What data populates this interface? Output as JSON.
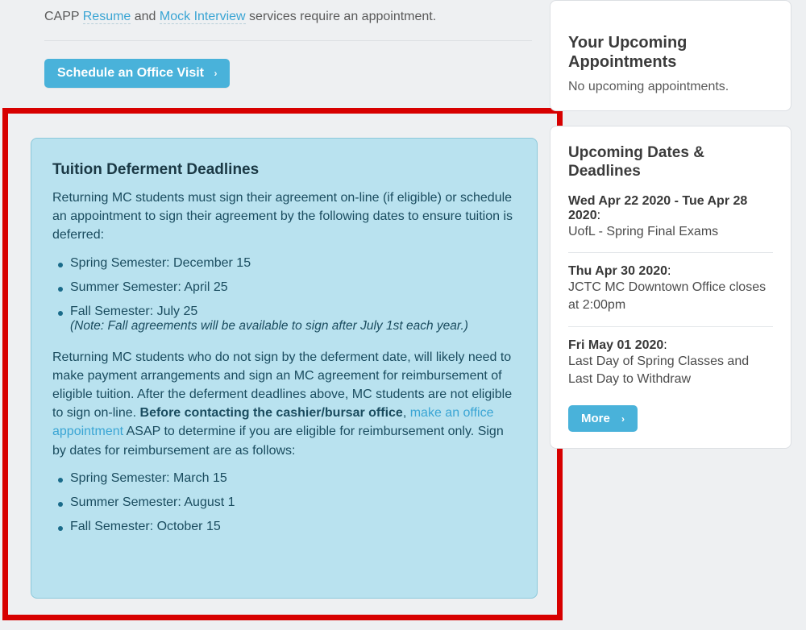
{
  "intro": {
    "prefix": "CAPP ",
    "link1": "Resume",
    "middle": " and ",
    "link2": "Mock Interview",
    "suffix": " services require an appointment."
  },
  "schedule_btn": "Schedule an Office Visit",
  "panel": {
    "heading": "Tuition Deferment Deadlines",
    "para1": "Returning MC students must sign their agreement on-line (if eligible) or schedule an appointment to sign their agreement by the following dates to ensure tuition is deferred:",
    "list1": {
      "li1": "Spring Semester: December 15",
      "li2": "Summer Semester: April 25",
      "li3": "Fall Semester: July 25",
      "li3_note": "(Note: Fall agreements will be available to sign after July 1st each year.)"
    },
    "para2_a": "Returning MC students who do not sign by the deferment date, will likely need to make payment arrangements and sign an MC agreement for reimbursement of eligible tuition. After the deferment deadlines above, MC students are not eligible to sign on-line. ",
    "para2_bold": "Before contacting the cashier/bursar office",
    "para2_b": ", ",
    "para2_link": "make an office appointment",
    "para2_c": " ASAP to determine if you are eligible for reimbursement only. Sign by dates for reimbursement are as follows:",
    "list2": {
      "li1": "Spring Semester: March 15",
      "li2": "Summer Semester: August 1",
      "li3": "Fall Semester: October 15"
    }
  },
  "sidebar": {
    "appts_heading": "Your Upcoming Appointments",
    "appts_empty": "No upcoming appointments.",
    "deadlines_heading": "Upcoming Dates & Deadlines",
    "events": [
      {
        "date": "Wed Apr 22 2020 - Tue Apr 28 2020",
        "desc": "UofL - Spring Final Exams"
      },
      {
        "date": "Thu Apr 30 2020",
        "desc": "JCTC MC Downtown Office closes at 2:00pm"
      },
      {
        "date": "Fri May 01 2020",
        "desc": "Last Day of Spring Classes and Last Day to Withdraw"
      }
    ],
    "more_btn": "More"
  }
}
